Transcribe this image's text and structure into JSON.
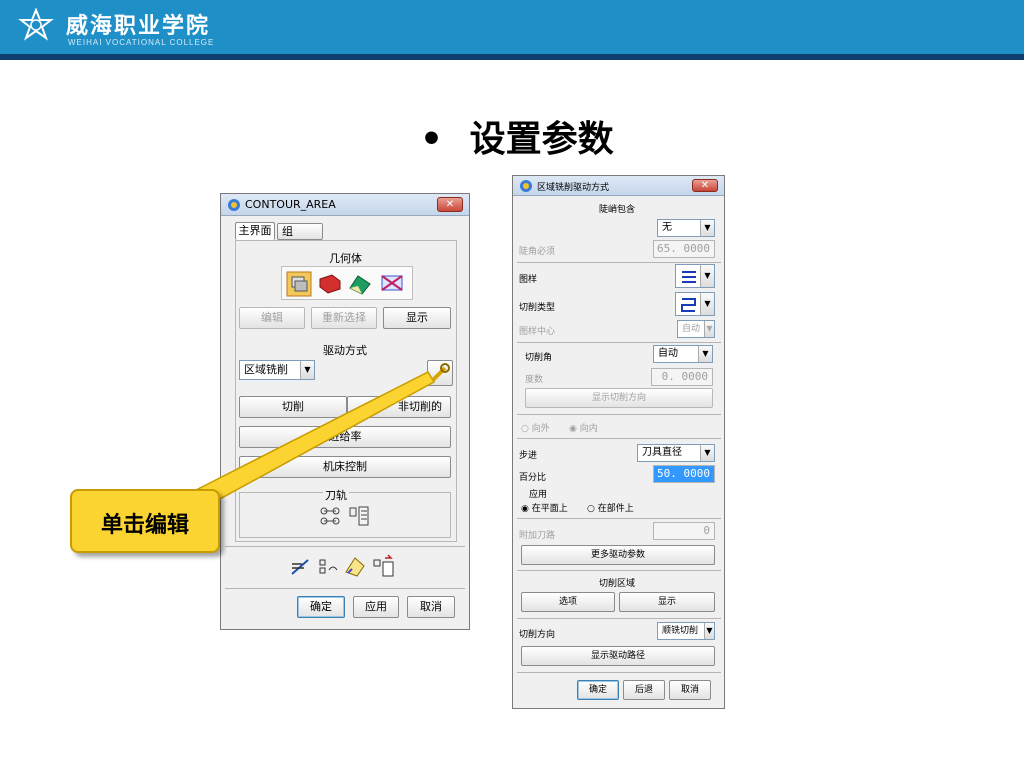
{
  "header": {
    "school_name": "威海职业学院",
    "school_en": "WEIHAI VOCATIONAL COLLEGE",
    "logo_icon": "school-logo-icon",
    "bg_color": "#1f8fc8"
  },
  "slide": {
    "bullet": "•",
    "title": "设置参数"
  },
  "callout": {
    "text": "单击编辑",
    "color": "#fcd431"
  },
  "left_dialog": {
    "title": "CONTOUR_AREA",
    "close": "✕",
    "tabs": [
      "主界面",
      "组"
    ],
    "geometry_label": "几何体",
    "geometry_icons": [
      "part-icon",
      "blank-icon",
      "check-icon",
      "cut-area-icon"
    ],
    "buttons": {
      "edit": "编辑",
      "reselect": "重新选择",
      "show": "显示"
    },
    "drive_label": "驱动方式",
    "drive_select": "区域铣削",
    "edit_icon": "wrench-icon",
    "cut": "切削",
    "non_cut": "非切削的",
    "feed": "进给率",
    "machine": "机床控制",
    "toolpath_label": "刀轨",
    "bottom": {
      "ok": "确定",
      "apply": "应用",
      "cancel": "取消"
    }
  },
  "right_dialog": {
    "title": "区域铣削驱动方式",
    "close": "✕",
    "steep_label": "陡峭包含",
    "steep_select": "无",
    "steep_angle_label": "陡角必须",
    "steep_angle_value": "65. 0000",
    "pattern_label": "图样",
    "cut_type_label": "切削类型",
    "pattern_center_label": "图样中心",
    "pattern_center_select": "自动",
    "cut_angle_label": "切削角",
    "cut_angle_select": "自动",
    "degree_label": "度数",
    "degree_value": "0. 0000",
    "show_direction": "显示切削方向",
    "outward": "向外",
    "inward": "向内",
    "stepover_label": "步进",
    "stepover_select": "刀具直径",
    "percent_label": "百分比",
    "percent_value": "50. 0000",
    "apply_label": "应用",
    "on_plane": "在平面上",
    "on_part": "在部件上",
    "extra_path_label": "附加刀路",
    "extra_path_value": "0",
    "more_params": "更多驱动参数",
    "cut_region_label": "切削区域",
    "options": "选项",
    "show": "显示",
    "cut_dir_label": "切削方向",
    "cut_dir_select": "顺铣切削",
    "show_drive_path": "显示驱动路径",
    "bottom": {
      "ok": "确定",
      "back": "后退",
      "cancel": "取消"
    }
  }
}
